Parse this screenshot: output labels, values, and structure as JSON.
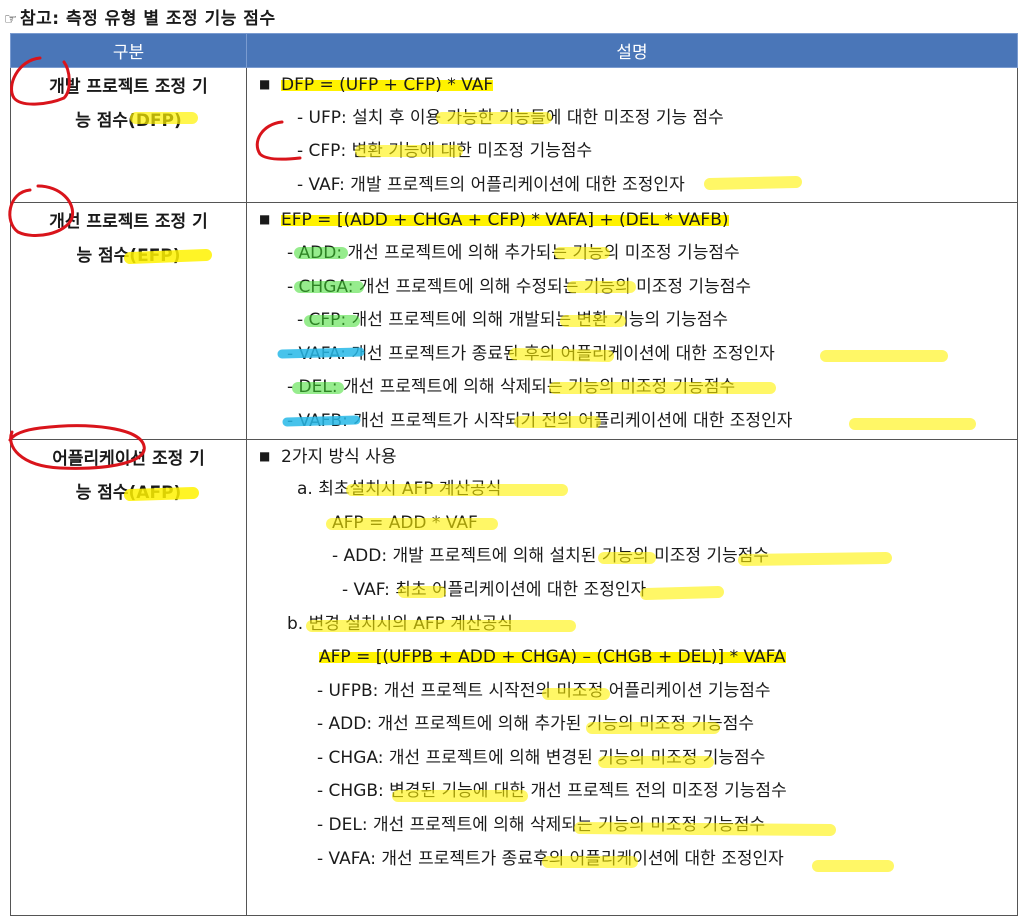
{
  "heading": {
    "pointer": "☞",
    "text": "참고: 측정 유형 별 조정 기능 점수"
  },
  "table": {
    "headers": [
      "구분",
      "설명"
    ],
    "rows": [
      {
        "label_lines": [
          "개발 프로젝트 조정 기",
          "능 점수(DFP)"
        ],
        "lines": [
          {
            "indent": 0,
            "bullet": "■",
            "text": "DFP = (UFP + CFP) * VAF"
          },
          {
            "indent": 50,
            "text": "- UFP: 설치 후 이용 가능한 기능들에 대한 미조정 기능 점수"
          },
          {
            "indent": 50,
            "text": "- CFP: 변환 기능에 대한 미조정 기능점수"
          },
          {
            "indent": 50,
            "text": "- VAF: 개발 프로젝트의 어플리케이션에 대한 조정인자"
          }
        ]
      },
      {
        "label_lines": [
          "개선 프로젝트 조정 기",
          "능 점수(EFP)"
        ],
        "lines": [
          {
            "indent": 0,
            "bullet": "■",
            "text": "EFP = [(ADD + CHGA + CFP) * VAFA] + (DEL * VAFB)"
          },
          {
            "indent": 40,
            "text": "- ADD: 개선 프로젝트에 의해 추가되는 기능의 미조정 기능점수"
          },
          {
            "indent": 40,
            "text": "- CHGA: 개선 프로젝트에 의해 수정되는 기능의 미조정 기능점수"
          },
          {
            "indent": 50,
            "text": "- CFP: 개선 프로젝트에 의해 개발되는 변환 기능의 기능점수"
          },
          {
            "indent": 40,
            "text": "- VAFA: 개선 프로젝트가 종료된 후의 어플리케이션에 대한 조정인자"
          },
          {
            "indent": 40,
            "text": "- DEL: 개선 프로젝트에 의해 삭제되는 기능의 미조정 기능점수"
          },
          {
            "indent": 40,
            "text": "- VAFB: 개선 프로젝트가 시작되기 전의 어플리케이션에 대한 조정인자"
          }
        ]
      },
      {
        "label_lines": [
          "어플리케이션 조정 기",
          "능 점수(AFP)"
        ],
        "lines": [
          {
            "indent": 0,
            "bullet": "■",
            "text": "2가지 방식 사용"
          },
          {
            "indent": 50,
            "text": "a.   최초설치시 AFP 계산공식"
          },
          {
            "indent": 85,
            "text": "AFP = ADD * VAF"
          },
          {
            "indent": 85,
            "text": "- ADD: 개발 프로젝트에 의해 설치된 기능의 미조정 기능점수"
          },
          {
            "indent": 95,
            "text": "- VAF: 최초 어플리케이션에 대한 조정인자"
          },
          {
            "indent": 40,
            "text": "b.  변경 설치시의 AFP 계산공식"
          },
          {
            "indent": 72,
            "text": "AFP = [(UFPB + ADD + CHGA) – (CHGB + DEL)] * VAFA"
          },
          {
            "indent": 70,
            "text": "- UFPB: 개선 프로젝트 시작전의 미조정 어플리케이션 기능점수"
          },
          {
            "indent": 70,
            "text": "- ADD: 개선 프로젝트에 의해 추가된 기능의 미조정 기능점수"
          },
          {
            "indent": 70,
            "text": "- CHGA: 개선 프로젝트에 의해 변경된 기능의 미조정 기능점수"
          },
          {
            "indent": 70,
            "text": "- CHGB: 변경된 기능에 대한 개선 프로젝트 전의 미조정 기능점수"
          },
          {
            "indent": 70,
            "text": "- DEL: 개선 프로젝트에 의해 삭제되는 기능의 미조정 기능점수"
          },
          {
            "indent": 70,
            "text": "- VAFA: 개선 프로젝트가 종료후의 어플리케이션에 대한 조정인자"
          }
        ]
      }
    ]
  },
  "colors": {
    "header_bg": "#4a76b8",
    "highlight_yellow": "#fff200",
    "highlight_green": "#3fdc2f",
    "highlight_blue": "#27b8e8",
    "ink_red": "#d9141b"
  }
}
